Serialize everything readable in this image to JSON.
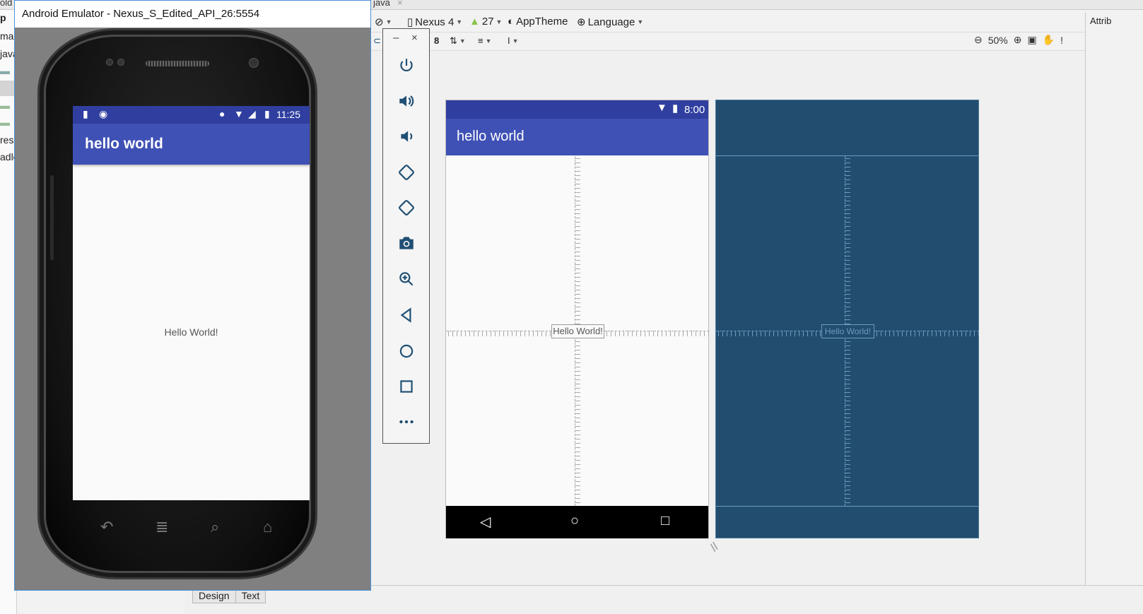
{
  "ide": {
    "top_tabs": [
      "old",
      "java"
    ],
    "left_panel_items": [
      "p",
      "ma",
      "java",
      "",
      "",
      "",
      "res",
      "adle"
    ],
    "toolbar": {
      "device": "Nexus 4",
      "api": "27",
      "theme": "AppTheme",
      "language": "Language",
      "number_8": "8",
      "zoom": "50%",
      "attributes_label": "Attrib"
    },
    "bottom_tabs": [
      "Design",
      "Text"
    ]
  },
  "design_preview": {
    "status_time": "8:00",
    "app_title": "hello world",
    "hello_text": "Hello World!"
  },
  "blueprint_preview": {
    "hello_text": "Hello World!"
  },
  "emulator": {
    "window_title": "Android Emulator - Nexus_S_Edited_API_26:5554",
    "status_time": "11:25",
    "app_title": "hello world",
    "hello_text": "Hello World!",
    "controls_header_minimize": "–",
    "controls_header_close": "×",
    "controls": [
      "power",
      "volume-up",
      "volume-down",
      "rotate-left",
      "rotate-right",
      "screenshot",
      "zoom",
      "back",
      "home",
      "overview",
      "more"
    ]
  },
  "colors": {
    "primary_dark": "#303F9F",
    "primary": "#3F51B5",
    "blueprint": "#234d6e",
    "control_icon": "#1f4f73"
  }
}
